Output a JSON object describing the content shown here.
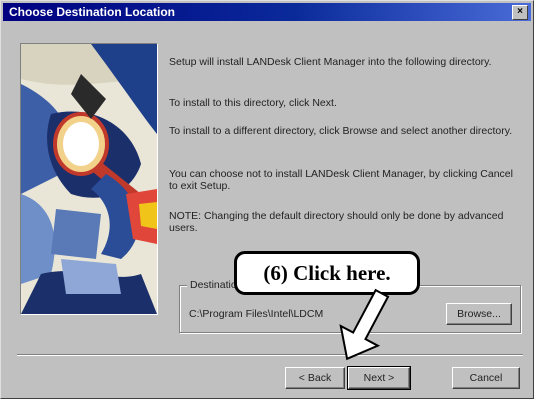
{
  "window": {
    "title": "Choose Destination Location",
    "close_glyph": "×"
  },
  "paragraphs": [
    "Setup will install LANDesk Client Manager into the following directory.",
    "To install to this directory, click Next.",
    "To install to a different directory, click Browse and select another directory.",
    "You can choose not to install LANDesk Client Manager, by clicking Cancel to exit Setup.",
    "NOTE: Changing the default directory should only be done by advanced users."
  ],
  "destination": {
    "group_label": "Destination Folder",
    "path": "C:\\Program Files\\Intel\\LDCM",
    "browse_label": "Browse..."
  },
  "buttons": {
    "back": "< Back",
    "next": "Next >",
    "cancel": "Cancel"
  },
  "callout": {
    "text": "(6)  Click here."
  },
  "colors": {
    "titlebar": "#000080",
    "face": "#c0c0c0"
  }
}
